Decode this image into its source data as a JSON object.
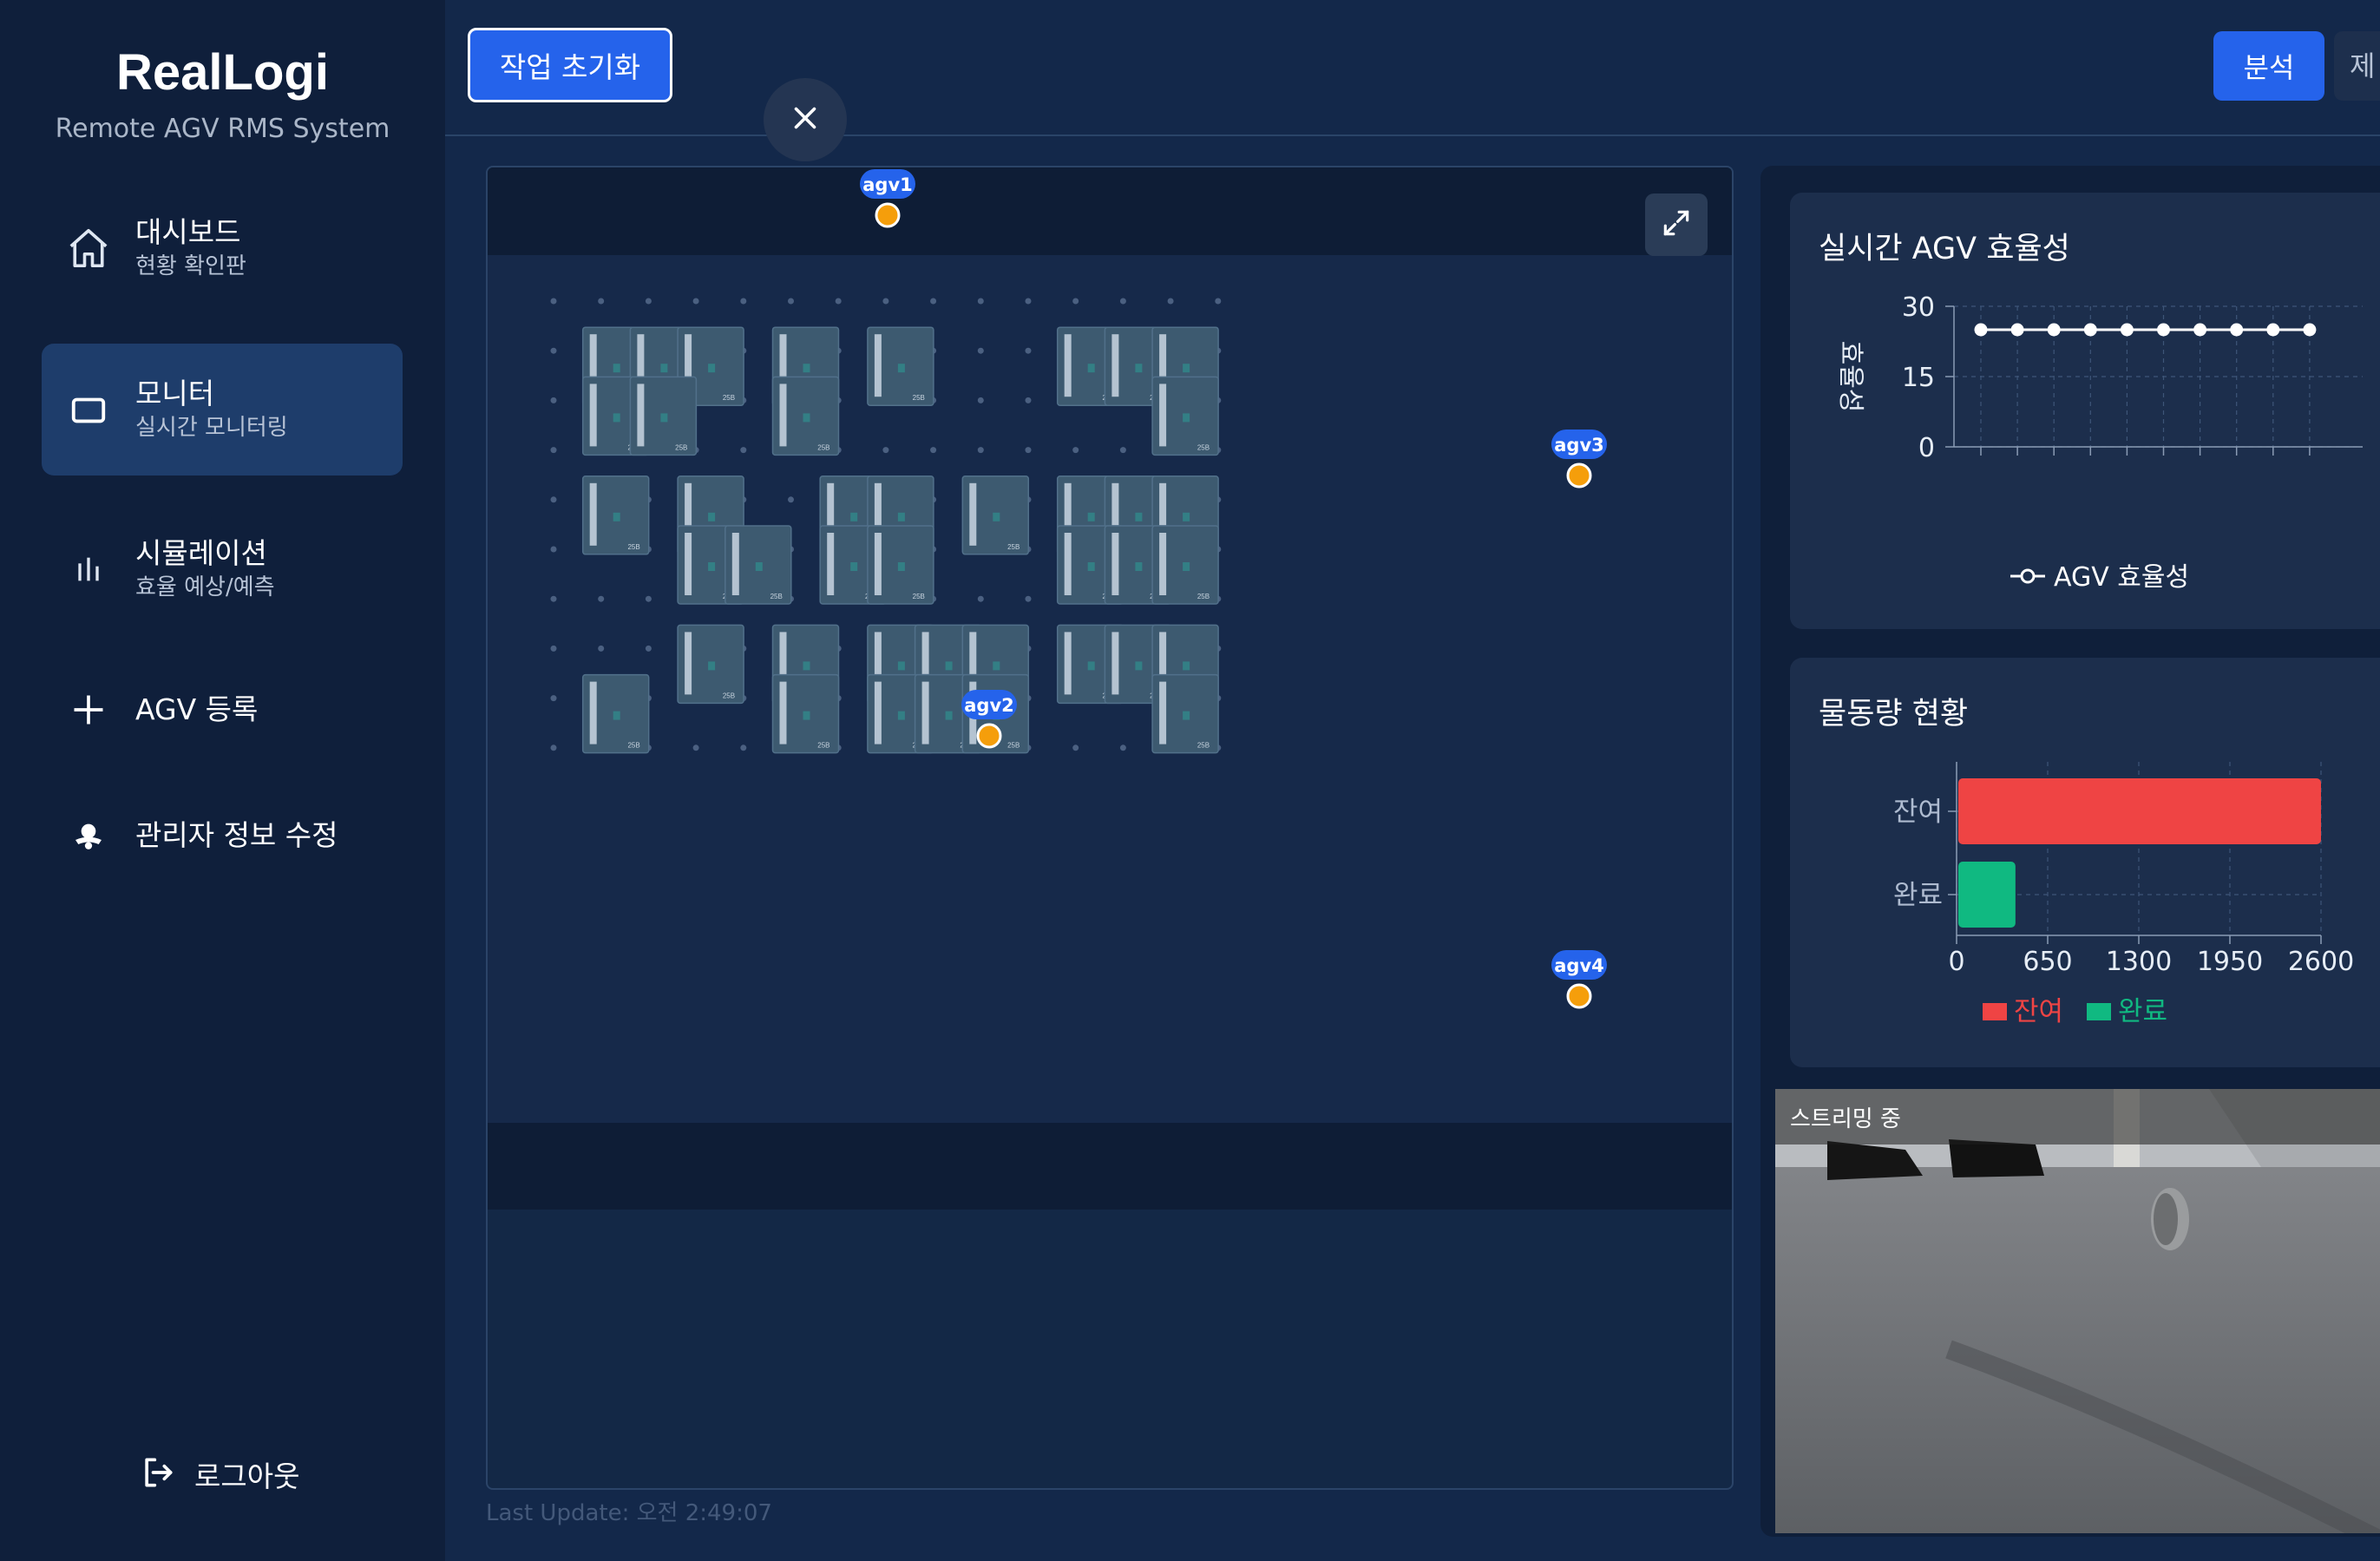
{
  "app": {
    "brand": "RealLogi",
    "subtitle": "Remote AGV RMS System"
  },
  "sidebar": {
    "items": [
      {
        "label": "대시보드",
        "desc": "현황 확인판",
        "icon": "home-icon",
        "active": false
      },
      {
        "label": "모니터",
        "desc": "실시간 모니터링",
        "icon": "monitor-icon",
        "active": true
      },
      {
        "label": "시뮬레이션",
        "desc": "효율 예상/예측",
        "icon": "bar-chart-icon",
        "active": false
      },
      {
        "label": "AGV 등록",
        "desc": "",
        "icon": "plus-icon",
        "active": false
      },
      {
        "label": "관리자 정보 수정",
        "desc": "",
        "icon": "admin-icon",
        "active": false
      }
    ],
    "logout": "로그아웃"
  },
  "topbar": {
    "reset_label": "작업 초기화",
    "analysis_label": "분석",
    "extra_tab_label": "제"
  },
  "map": {
    "last_update": "Last Update: 오전 2:49:07",
    "rack_label": "25B",
    "agvs": [
      {
        "name": "agv1"
      },
      {
        "name": "agv2"
      },
      {
        "name": "agv3"
      },
      {
        "name": "agv4"
      }
    ]
  },
  "efficiency_card": {
    "title": "실시간 AGV 효율성"
  },
  "flow_card": {
    "title": "물동량 현황"
  },
  "stream": {
    "label": "스트리밍 중"
  },
  "colors": {
    "accent": "#2563eb",
    "agv_marker": "#f59e0b",
    "remaining": "#ef4444",
    "completed": "#10b981"
  },
  "chart_data": [
    {
      "type": "line",
      "title": "",
      "ylabel": "효율성",
      "xlabel": "",
      "ylim": [
        0,
        30
      ],
      "yticks": [
        0,
        15,
        30
      ],
      "x": [
        1,
        2,
        3,
        4,
        5,
        6,
        7,
        8,
        9,
        10
      ],
      "series": [
        {
          "name": "AGV 효율성",
          "values": [
            25,
            25,
            25,
            25,
            25,
            25,
            25,
            25,
            25,
            25
          ],
          "color": "#ffffff"
        }
      ],
      "grid": true,
      "legend": "bottom"
    },
    {
      "type": "bar",
      "orientation": "horizontal",
      "categories": [
        "잔여",
        "완료"
      ],
      "series": [
        {
          "name": "잔여",
          "values": [
            2600,
            0
          ],
          "color": "#ef4444"
        },
        {
          "name": "완료",
          "values": [
            0,
            420
          ],
          "color": "#10b981"
        }
      ],
      "xlim": [
        0,
        2600
      ],
      "xticks": [
        0,
        650,
        1300,
        1950,
        2600
      ],
      "grid": true,
      "legend": "bottom"
    }
  ]
}
